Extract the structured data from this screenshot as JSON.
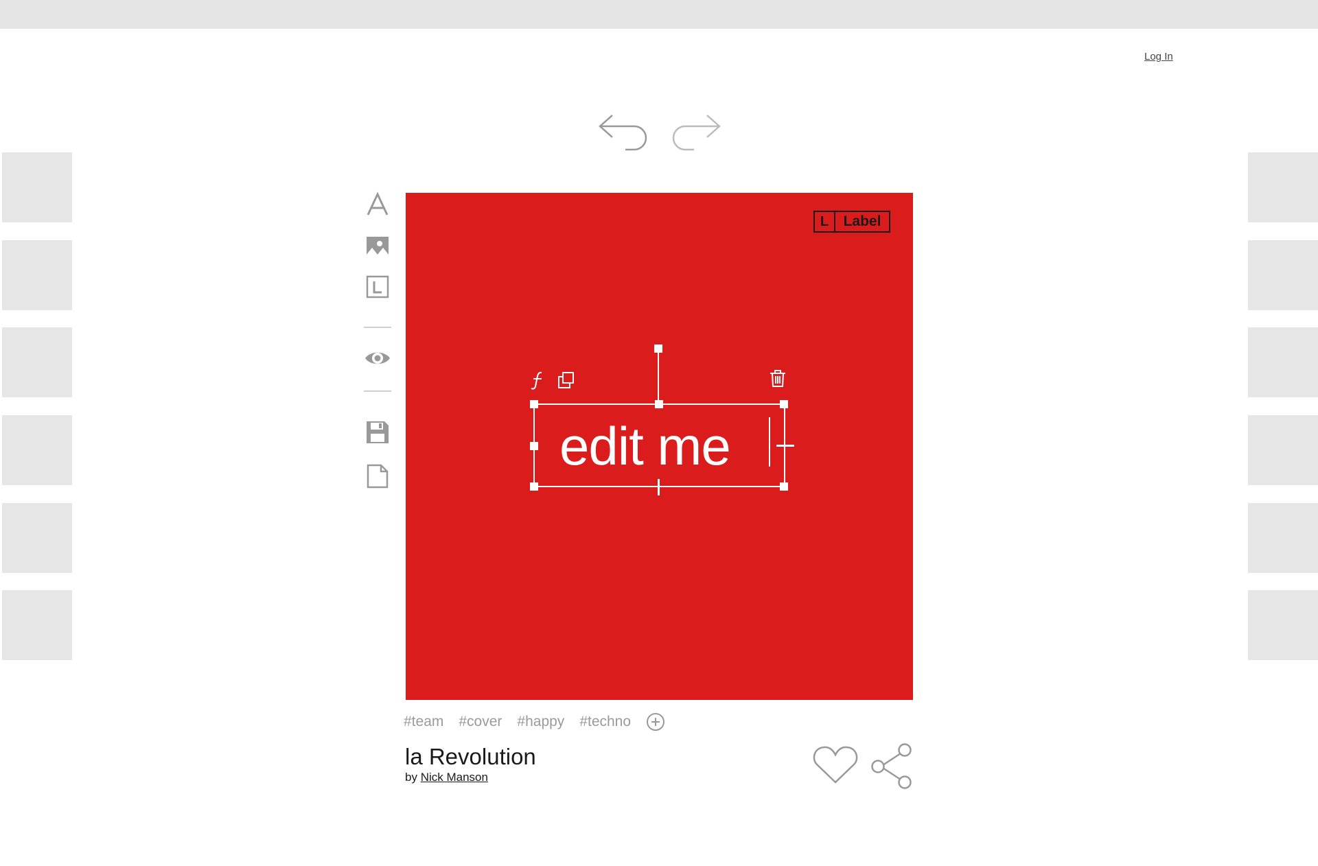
{
  "header": {
    "login_label": "Log In"
  },
  "history": {
    "undo_icon": "undo-arrow-icon",
    "redo_icon": "redo-arrow-icon"
  },
  "toolbar": {
    "items": [
      {
        "name": "text-tool",
        "icon": "letter-a-icon"
      },
      {
        "name": "image-tool",
        "icon": "image-icon"
      },
      {
        "name": "label-tool",
        "icon": "label-l-icon"
      },
      {
        "name": "preview-tool",
        "icon": "eye-icon"
      },
      {
        "name": "save-tool",
        "icon": "floppy-disk-icon"
      },
      {
        "name": "new-page-tool",
        "icon": "document-icon"
      }
    ]
  },
  "canvas": {
    "background_color": "#da1c1c",
    "brand": {
      "mark": "L",
      "text": "Label"
    },
    "text_element": {
      "text": "edit me",
      "color": "#ffffff"
    },
    "controls": [
      "font-icon",
      "duplicate-icon",
      "trash-icon"
    ]
  },
  "tags": [
    "#team",
    "#cover",
    "#happy",
    "#techno"
  ],
  "post": {
    "title": "la Revolution",
    "by_label": "by",
    "author": "Nick Manson"
  },
  "colors": {
    "accent": "#da1c1c",
    "icon_gray": "#999999",
    "placeholder_gray": "#e6e6e6"
  }
}
